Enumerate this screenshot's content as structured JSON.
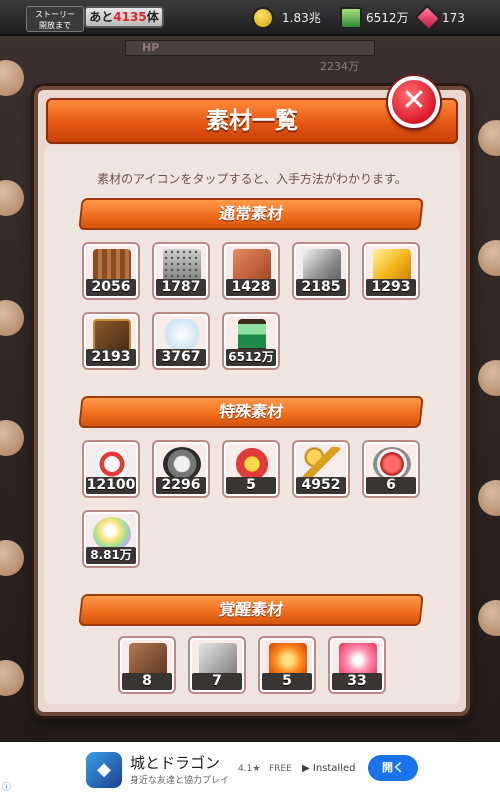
{
  "top_bar": {
    "story_label_line1": "ストーリー",
    "story_label_line2": "開放まで",
    "remain_prefix": "あと",
    "remain_count": "4135",
    "remain_suffix": "体",
    "gold": "1.83兆",
    "hourglass": "6512万",
    "gems": "173"
  },
  "background": {
    "hp_label": "HP",
    "hp_value": "2234万"
  },
  "modal": {
    "title": "素材一覧",
    "close_symbol": "✕",
    "hint": "素材のアイコンをタップすると、入手方法がわかります。",
    "sections": [
      {
        "title": "通常素材",
        "items": [
          {
            "icon": "wood-block-icon",
            "count": "2056"
          },
          {
            "icon": "stone-block-icon",
            "count": "1787"
          },
          {
            "icon": "copper-block-icon",
            "count": "1428"
          },
          {
            "icon": "steel-block-icon",
            "count": "2185"
          },
          {
            "icon": "gold-block-icon",
            "count": "1293"
          },
          {
            "icon": "spellbook-icon",
            "count": "2193"
          },
          {
            "icon": "ghost-cat-icon",
            "count": "3767"
          },
          {
            "icon": "green-hourglass-icon",
            "count": "6512万"
          }
        ]
      },
      {
        "title": "特殊素材",
        "items": [
          {
            "icon": "p-cat-medal-icon",
            "count": "12100"
          },
          {
            "icon": "silver-cat-coin-icon",
            "count": "2296"
          },
          {
            "icon": "star-ribbon-medal-icon",
            "count": "5"
          },
          {
            "icon": "golden-key-icon",
            "count": "4952"
          },
          {
            "icon": "red-potion-bag-icon",
            "count": "6"
          },
          {
            "icon": "rainbow-orb-icon",
            "count": "8.81万"
          }
        ]
      },
      {
        "title": "覚醒素材",
        "items": [
          {
            "icon": "bronze-puzzle-piece-icon",
            "count": "8"
          },
          {
            "icon": "silver-puzzle-piece-icon",
            "count": "7"
          },
          {
            "icon": "fire-puzzle-piece-icon",
            "count": "5"
          },
          {
            "icon": "rainbow-puzzle-piece-icon",
            "count": "33"
          }
        ]
      }
    ]
  },
  "ad": {
    "title": "城とドラゴン",
    "subtitle": "身近な友達と協力プレイ",
    "rating": "4.1★",
    "price": "FREE",
    "installed": "Installed",
    "open_label": "開く",
    "info_symbol": "ⓘ"
  }
}
